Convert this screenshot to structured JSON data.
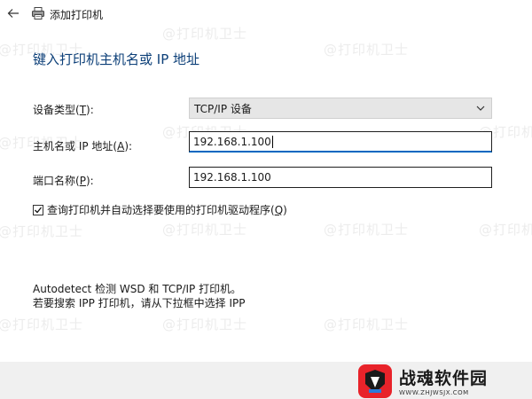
{
  "window": {
    "title": "添加打印机"
  },
  "heading": "键入打印机主机名或 IP 地址",
  "form": {
    "device_type": {
      "label_pre": "设备类型(",
      "hotkey": "T",
      "label_post": "):",
      "value": "TCP/IP 设备"
    },
    "host": {
      "label_pre": "主机名或 IP 地址(",
      "hotkey": "A",
      "label_post": "):",
      "value": "192.168.1.100"
    },
    "port": {
      "label_pre": "端口名称(",
      "hotkey": "P",
      "label_post": "):",
      "value": "192.168.1.100"
    },
    "query_driver": {
      "label_pre": "查询打印机并自动选择要使用的打印机驱动程序(",
      "hotkey": "Q",
      "label_post": ")",
      "checked": true
    }
  },
  "info": {
    "line1": "Autodetect 检测 WSD 和 TCP/IP 打印机。",
    "line2": "若要搜索 IPP 打印机，请从下拉框中选择 IPP"
  },
  "watermark": "@打印机卫士",
  "brand": {
    "name": "战魂软件园",
    "url": "WWW.ZHJWSJX.COM"
  },
  "colors": {
    "heading": "#0c3f78",
    "focus_underline": "#0067c0",
    "footer_bg": "#f0f0f0"
  },
  "icons": [
    "back-arrow-icon",
    "printer-icon",
    "chevron-down-icon",
    "checkmark-icon"
  ]
}
